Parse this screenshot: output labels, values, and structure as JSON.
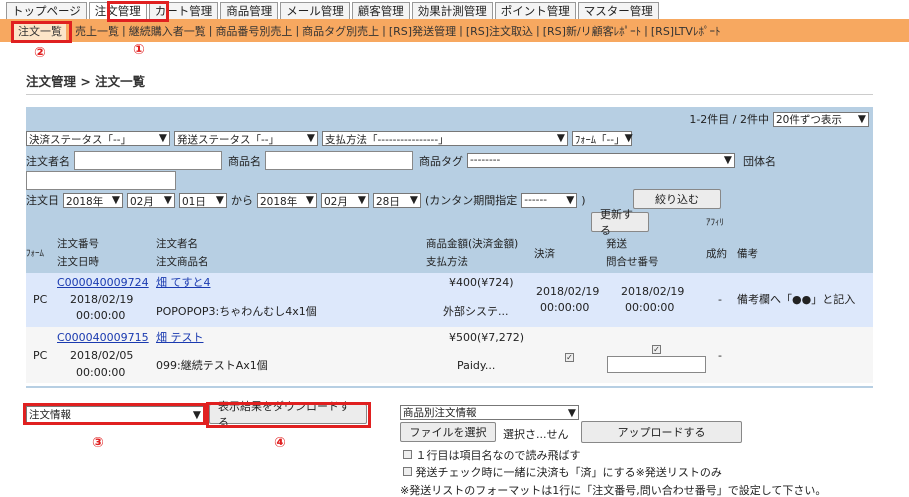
{
  "top_tabs": [
    "トップページ",
    "注文管理",
    "カート管理",
    "商品管理",
    "メール管理",
    "顧客管理",
    "効果計測管理",
    "ポイント管理",
    "マスター管理"
  ],
  "sub_nav": [
    "注文一覧",
    "売上一覧",
    "継続購入者一覧",
    "商品番号別売上",
    "商品タグ別売上",
    "[RS]発送管理",
    "[RS]注文取込",
    "[RS]新/リ顧客ﾚﾎﾟｰﾄ",
    "[RS]LTVﾚﾎﾟｰﾄ"
  ],
  "breadcrumb": "注文管理 > 注文一覧",
  "count_text": "1-2件目 / 2件中",
  "per_page": "20件ずつ表示",
  "filters": {
    "payment_status": "決済ステータス「--」",
    "ship_status": "発送ステータス「--」",
    "pay_method": "支払方法「----------------」",
    "form": "ﾌｫｰﾑ「--」",
    "orderer_label": "注文者名",
    "product_label": "商品名",
    "tag_label": "商品タグ",
    "tag_value": "--------",
    "group_label": "団体名",
    "date_label": "注文日",
    "from_year": "2018年",
    "from_month": "02月",
    "from_day": "01日",
    "kara": "から",
    "to_year": "2018年",
    "to_month": "02月",
    "to_day": "28日",
    "easy_label": "(カンタン期間指定",
    "easy_value": "------",
    "easy_close": ")",
    "filter_button": "絞り込む",
    "update_button": "更新する",
    "affiliate": "ｱﾌｨﾘ"
  },
  "headers": {
    "form": "ﾌｫｰﾑ",
    "order_no": "注文番号",
    "order_date": "注文日時",
    "orderer": "注文者名",
    "product": "注文商品名",
    "amount": "商品金額(決済金額)",
    "method": "支払方法",
    "settle": "決済",
    "ship": "発送",
    "inquiry": "問合せ番号",
    "success": "成約",
    "memo": "備考"
  },
  "orders": [
    {
      "form": "PC",
      "order_no": "C000040009724",
      "date": "2018/02/19",
      "time": "00:00:00",
      "orderer": "畑 てすと4",
      "product": "POPOPOP3:ちゃわんむし4x1個",
      "amount": "¥400(¥724)",
      "method": "外部システ...",
      "settle_date": "2018/02/19",
      "settle_time": "00:00:00",
      "ship_date": "2018/02/19",
      "ship_time": "00:00:00",
      "success": "-",
      "memo": "備考欄へ「●●」と記入"
    },
    {
      "form": "PC",
      "order_no": "C000040009715",
      "date": "2018/02/05",
      "time": "00:00:00",
      "orderer": "畑 テスト",
      "product": "099:継続テストAx1個",
      "amount": "¥500(¥7,272)",
      "method": "Paidy...",
      "success": "-"
    }
  ],
  "bottom": {
    "download_type": "注文情報",
    "download_button": "表示結果をダウンロードする",
    "upload_type": "商品別注文情報",
    "file_button": "ファイルを選択",
    "file_status": "選択さ...せん",
    "upload_button": "アップロードする",
    "opt1": "１行目は項目名なので読み飛ばす",
    "opt2": "発送チェック時に一緒に決済も「済」にする※発送リストのみ",
    "note": "※発送リストのフォーマットは1行に「注文番号,問い合わせ番号」で設定して下さい。"
  },
  "markers": [
    "①",
    "②",
    "③",
    "④"
  ],
  "colors": {
    "subnav_bg": "#f7a860",
    "panel_bg": "#b7cfe3",
    "highlight_row": "#dde8fb",
    "marker_red": "#e02020"
  }
}
